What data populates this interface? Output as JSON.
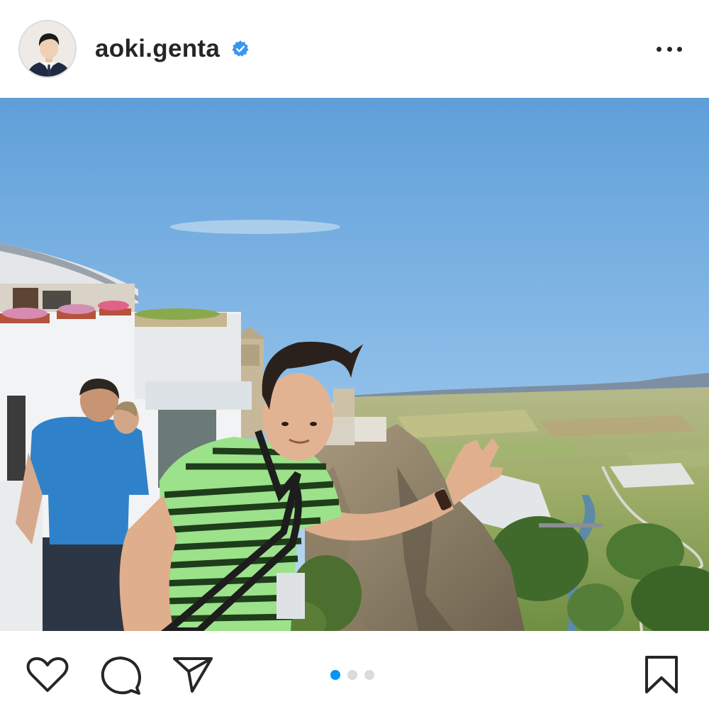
{
  "post": {
    "username": "aoki.genta",
    "verified": true,
    "avatar_icon": "profile-avatar",
    "more_icon": "more-horizontal-icon"
  },
  "media": {
    "description_icon": "post-photo",
    "carousel": {
      "count": 3,
      "active": 1
    }
  },
  "actions": {
    "like_icon": "heart-icon",
    "comment_icon": "comment-icon",
    "share_icon": "send-icon",
    "save_icon": "bookmark-icon"
  },
  "colors": {
    "accent": "#0095f6",
    "verified": "#3897f0",
    "text": "#262626",
    "inactive_dot": "#dbdbdb"
  }
}
